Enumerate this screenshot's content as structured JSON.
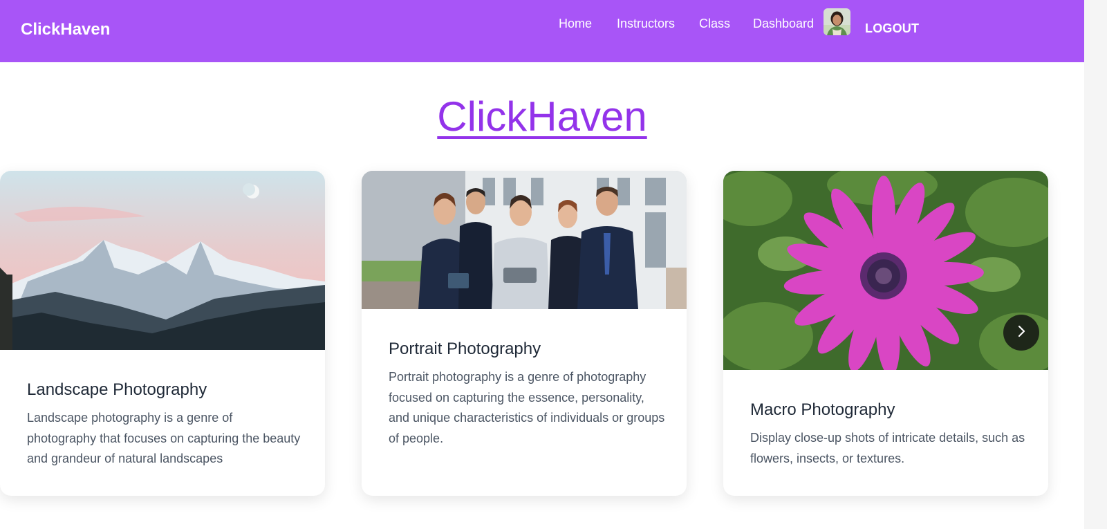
{
  "navbar": {
    "brand": "ClickHaven",
    "links": {
      "home": "Home",
      "instructors": "Instructors",
      "class": "Class",
      "dashboard": "Dashboard"
    },
    "logout": "LOGOUT",
    "background": "#a855f7"
  },
  "hero": {
    "title": "ClickHaven",
    "color": "#9333ea"
  },
  "cards": [
    {
      "title": "Landscape Photography",
      "description": "Landscape photography is a genre of photography that focuses on capturing the beauty and grandeur of natural landscapes",
      "image": "snowy-mountain-range"
    },
    {
      "title": "Portrait Photography",
      "description": "Portrait photography is a genre of photography focused on capturing the essence, personality, and unique characteristics of individuals or groups of people.",
      "image": "business-group-portrait"
    },
    {
      "title": "Macro Photography",
      "description": "Display close-up shots of intricate details, such as flowers, insects, or textures.",
      "image": "purple-daisy-flower"
    }
  ],
  "carousel": {
    "next_icon": "chevron-right-icon"
  }
}
